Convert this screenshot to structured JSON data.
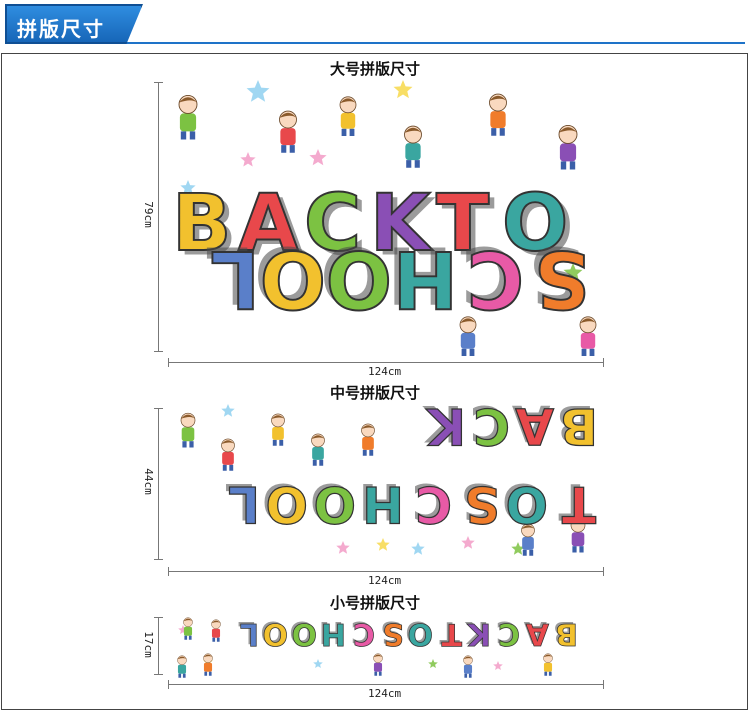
{
  "header": {
    "title": "拼版尺寸"
  },
  "sections": [
    {
      "title": "大号拼版尺寸",
      "width_label": "124cm",
      "height_label": "79cm"
    },
    {
      "title": "中号拼版尺寸",
      "width_label": "124cm",
      "height_label": "44cm"
    },
    {
      "title": "小号拼版尺寸",
      "width_label": "124cm",
      "height_label": "17cm"
    }
  ],
  "artwork": {
    "line1": "BACKTO",
    "line2": "SCHOOL",
    "letter_colors": [
      "#f2c12e",
      "#e8484b",
      "#7cc242",
      "#8a4fb5",
      "#e8484b",
      "#3aa6a0",
      "#f07c2b",
      "#e85aa6",
      "#3aa6a0",
      "#7cc242",
      "#f2c12e",
      "#5a7fc9"
    ],
    "accent_colors": {
      "brand_blue": "#1e73c8",
      "star_blue": "#8fd0f0",
      "star_yellow": "#f7d84a",
      "star_pink": "#f29bc6"
    }
  }
}
